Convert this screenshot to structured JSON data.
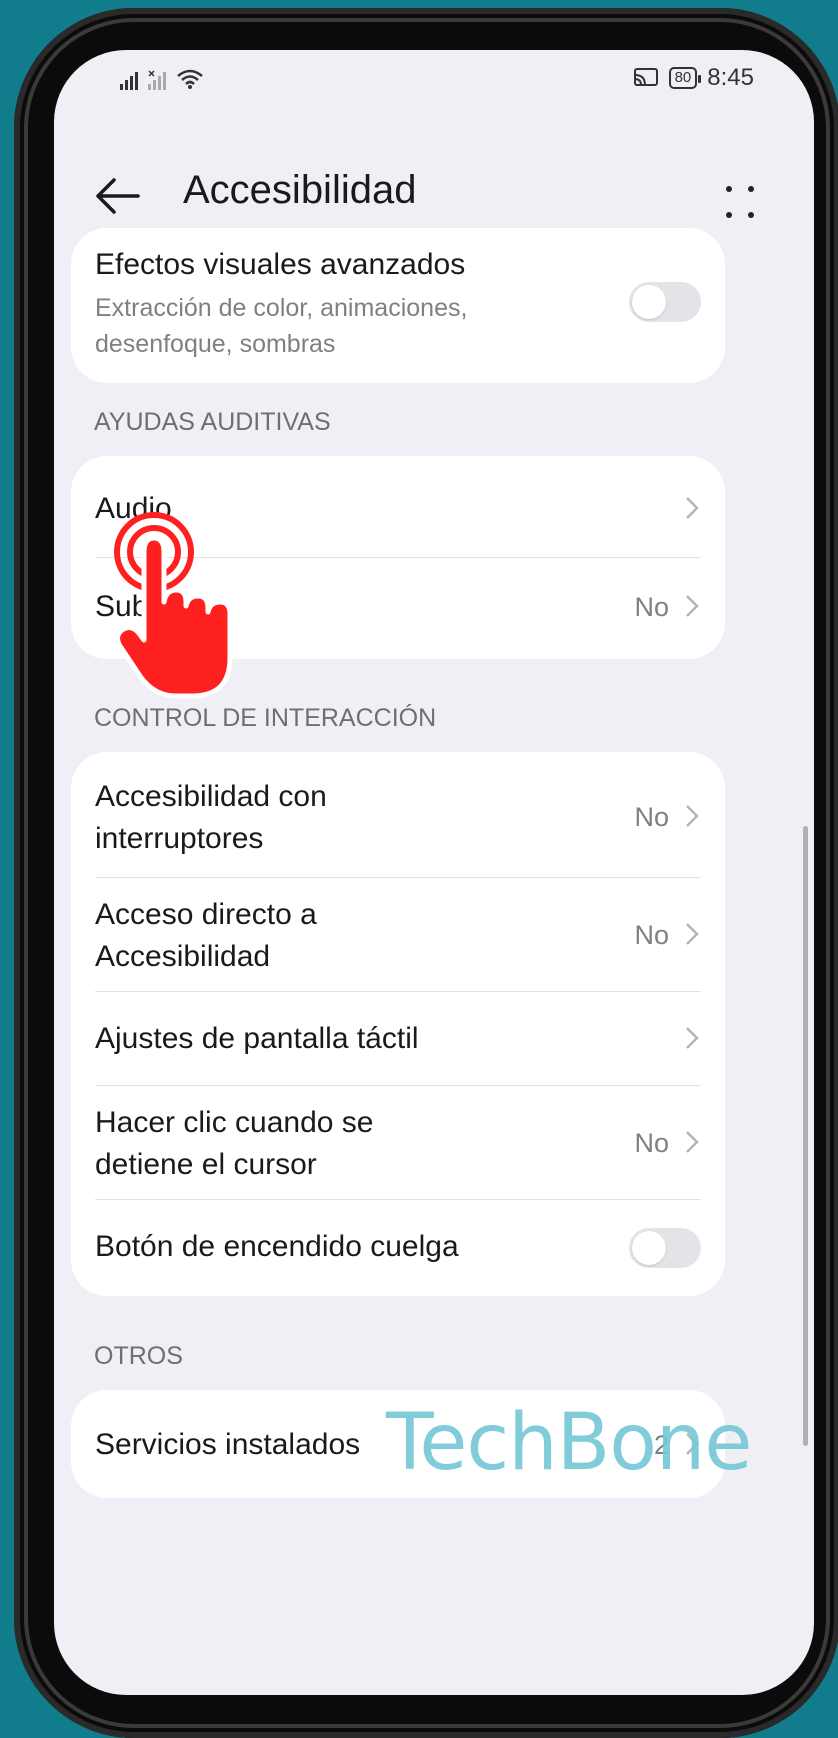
{
  "status_bar": {
    "time": "8:45",
    "battery": "80"
  },
  "app_bar": {
    "title": "Accesibilidad"
  },
  "visual_effects": {
    "title": "Efectos visuales avanzados",
    "subtitle_line1": "Extracción de color, animaciones,",
    "subtitle_line2": "desenfoque, sombras",
    "toggle_on": false
  },
  "sections": {
    "hearing": {
      "header": "AYUDAS AUDITIVAS",
      "items": [
        {
          "label": "Audio",
          "value": ""
        },
        {
          "label": "Subt",
          "value": "No"
        }
      ]
    },
    "interaction": {
      "header": "CONTROL DE INTERACCIÓN",
      "items": [
        {
          "label_line1": "Accesibilidad con",
          "label_line2": "interruptores",
          "value": "No"
        },
        {
          "label_line1": "Acceso directo a",
          "label_line2": "Accesibilidad",
          "value": "No"
        },
        {
          "label": "Ajustes de pantalla táctil",
          "value": ""
        },
        {
          "label_line1": "Hacer clic cuando se",
          "label_line2": "detiene el cursor",
          "value": "No"
        },
        {
          "label": "Botón de encendido cuelga",
          "toggle_on": false
        }
      ]
    },
    "others": {
      "header": "OTROS",
      "items": [
        {
          "label": "Servicios instalados",
          "value": "2"
        }
      ]
    }
  },
  "watermark": "TechBone",
  "icons": [
    "signal-icon",
    "wifi-icon",
    "cast-icon",
    "battery-icon",
    "back-arrow-icon",
    "more-icon",
    "chevron-right-icon",
    "tap-hand-icon"
  ],
  "colors": {
    "background": "#117c8c",
    "screen": "#f0eff6",
    "card": "#ffffff",
    "tap_hand": "#ff2020",
    "watermark": "#76c8d6"
  }
}
